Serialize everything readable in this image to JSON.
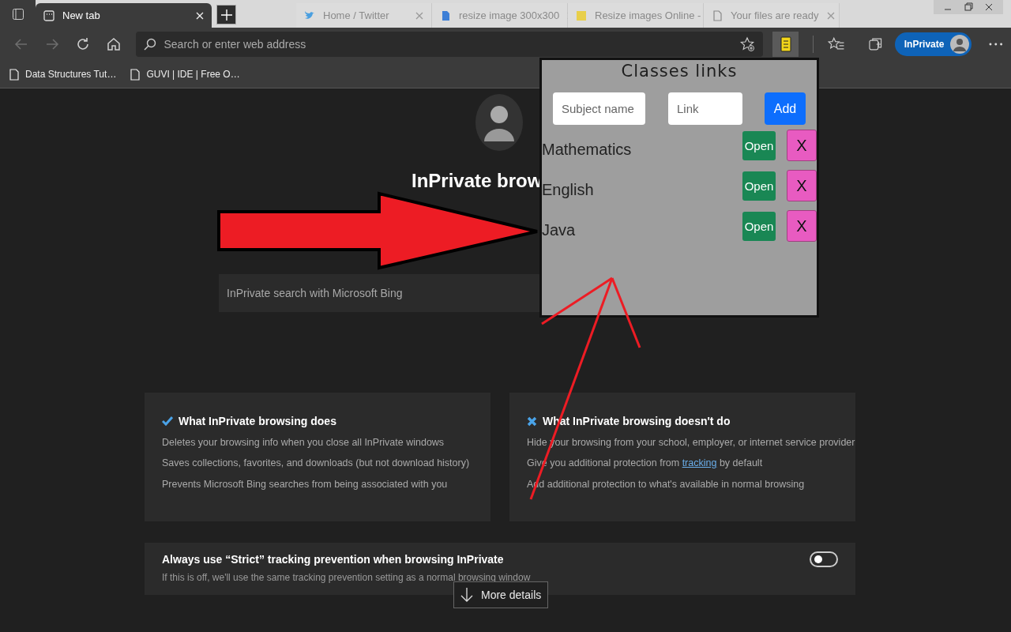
{
  "browser": {
    "tabs": [
      {
        "title": "New tab",
        "selected": true
      },
      {
        "title": "Home / Twitter",
        "selected": false
      },
      {
        "title": "resize image 300x300",
        "selected": false
      },
      {
        "title": "Resize images Online -",
        "selected": false
      },
      {
        "title": "Your files are ready",
        "selected": false
      }
    ],
    "nav": [
      {
        "kind": "back",
        "disabled": true
      },
      {
        "kind": "forward",
        "disabled": true
      },
      {
        "kind": "refresh",
        "disabled": false
      },
      {
        "kind": "home",
        "disabled": false
      }
    ],
    "address": {
      "placeholder": "Search or enter web address"
    },
    "extension": {
      "highlighted": true
    },
    "profile": {
      "label": "InPrivate"
    },
    "bookmarks": [
      {
        "title": "Data Structures Tut…"
      },
      {
        "title": "GUVI | IDE | Free O…"
      }
    ]
  },
  "page": {
    "heading": "InPrivate brow",
    "search": {
      "placeholder": "InPrivate search with Microsoft Bing"
    },
    "cards": [
      {
        "kind": "does",
        "title": "What InPrivate browsing does",
        "items": [
          {
            "text": "Deletes your browsing info when you close all InPrivate windows"
          },
          {
            "text": "Saves collections, favorites, and downloads (but not download history)"
          },
          {
            "text": "Prevents Microsoft Bing searches from being associated with you"
          }
        ]
      },
      {
        "kind": "doesnt",
        "title": "What InPrivate browsing doesn't do",
        "items": [
          {
            "text": "Hide your browsing from your school, employer, or internet service provider"
          },
          {
            "text": "Give you additional protection from ",
            "link": "tracking",
            "after": " by default"
          },
          {
            "text": "Add additional protection to what's available in normal browsing"
          }
        ]
      }
    ],
    "strict": {
      "title": "Always use “Strict” tracking prevention when browsing InPrivate",
      "description": "If this is off, we'll use the same tracking prevention setting as a normal browsing window",
      "toggle": {
        "on": false
      }
    },
    "more_details": "More details"
  },
  "popup": {
    "title": "Classes links",
    "subject": {
      "placeholder": "Subject name"
    },
    "link": {
      "placeholder": "Link"
    },
    "add": "Add",
    "rows": [
      {
        "name": "Mathematics",
        "open": "Open",
        "remove": "X"
      },
      {
        "name": "English",
        "open": "Open",
        "remove": "X"
      },
      {
        "name": "Java",
        "open": "Open",
        "remove": "X"
      }
    ]
  }
}
